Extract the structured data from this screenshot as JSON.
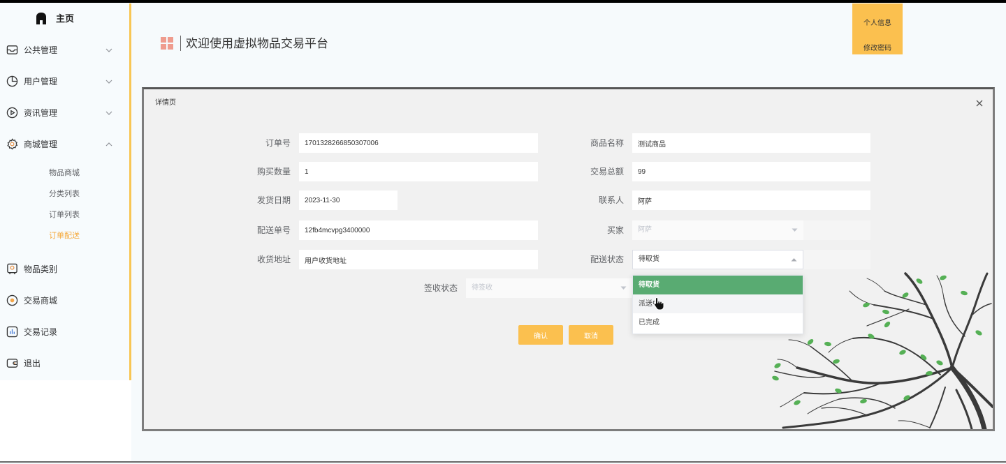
{
  "colors": {
    "accent": "#fbc04f",
    "menu_active": "#f6a93b",
    "option_selected": "#59ab72",
    "header_icon": "#ef9c8e",
    "sidebar_border": "#f8c654"
  },
  "sidebar": {
    "home": {
      "label": "主页",
      "icon": "home-icon"
    },
    "menus": [
      {
        "label": "公共管理",
        "icon": "inbox-icon",
        "expanded": false
      },
      {
        "label": "用户管理",
        "icon": "pie-chart-icon",
        "expanded": false
      },
      {
        "label": "资讯管理",
        "icon": "play-circle-icon",
        "expanded": false
      },
      {
        "label": "商城管理",
        "icon": "settings-icon",
        "expanded": true,
        "children": [
          {
            "label": "物品商城",
            "active": false
          },
          {
            "label": "分类列表",
            "active": false
          },
          {
            "label": "订单列表",
            "active": false
          },
          {
            "label": "订单配送",
            "active": true
          }
        ]
      },
      {
        "label": "物品类别",
        "icon": "badge-icon"
      },
      {
        "label": "交易商城",
        "icon": "sun-icon"
      },
      {
        "label": "交易记录",
        "icon": "bar-chart-icon"
      },
      {
        "label": "退出",
        "icon": "wallet-icon"
      }
    ]
  },
  "header": {
    "icon": "grid-icon",
    "title": "欢迎使用虚拟物品交易平台",
    "user_menu": {
      "profile_label": "个人信息",
      "change_password_label": "修改密码"
    }
  },
  "dialog": {
    "title": "详情页",
    "close_icon": "close-icon",
    "fields": {
      "order_no": {
        "label": "订单号",
        "value": "1701328266850307006"
      },
      "product_name": {
        "label": "商品名称",
        "value": "测试商品"
      },
      "quantity": {
        "label": "购买数量",
        "value": "1"
      },
      "total": {
        "label": "交易总额",
        "value": "99"
      },
      "ship_date": {
        "label": "发货日期",
        "value": "2023-11-30"
      },
      "contact": {
        "label": "联系人",
        "value": "阿萨"
      },
      "delivery_no": {
        "label": "配送单号",
        "value": "12fb4mcvpg3400000"
      },
      "buyer": {
        "label": "买家",
        "value": "阿萨",
        "disabled": true
      },
      "address": {
        "label": "收货地址",
        "value": "用户收货地址"
      },
      "delivery_status": {
        "label": "配送状态",
        "value": "待取货",
        "open": true,
        "options": [
          {
            "label": "待取货",
            "selected": true,
            "hovered": false
          },
          {
            "label": "派送中",
            "selected": false,
            "hovered": true
          },
          {
            "label": "已完成",
            "selected": false,
            "hovered": false
          }
        ]
      },
      "sign_status": {
        "label": "签收状态",
        "value": "待签收",
        "disabled": true
      }
    },
    "actions": {
      "confirm_label": "确认",
      "cancel_label": "取消"
    }
  }
}
